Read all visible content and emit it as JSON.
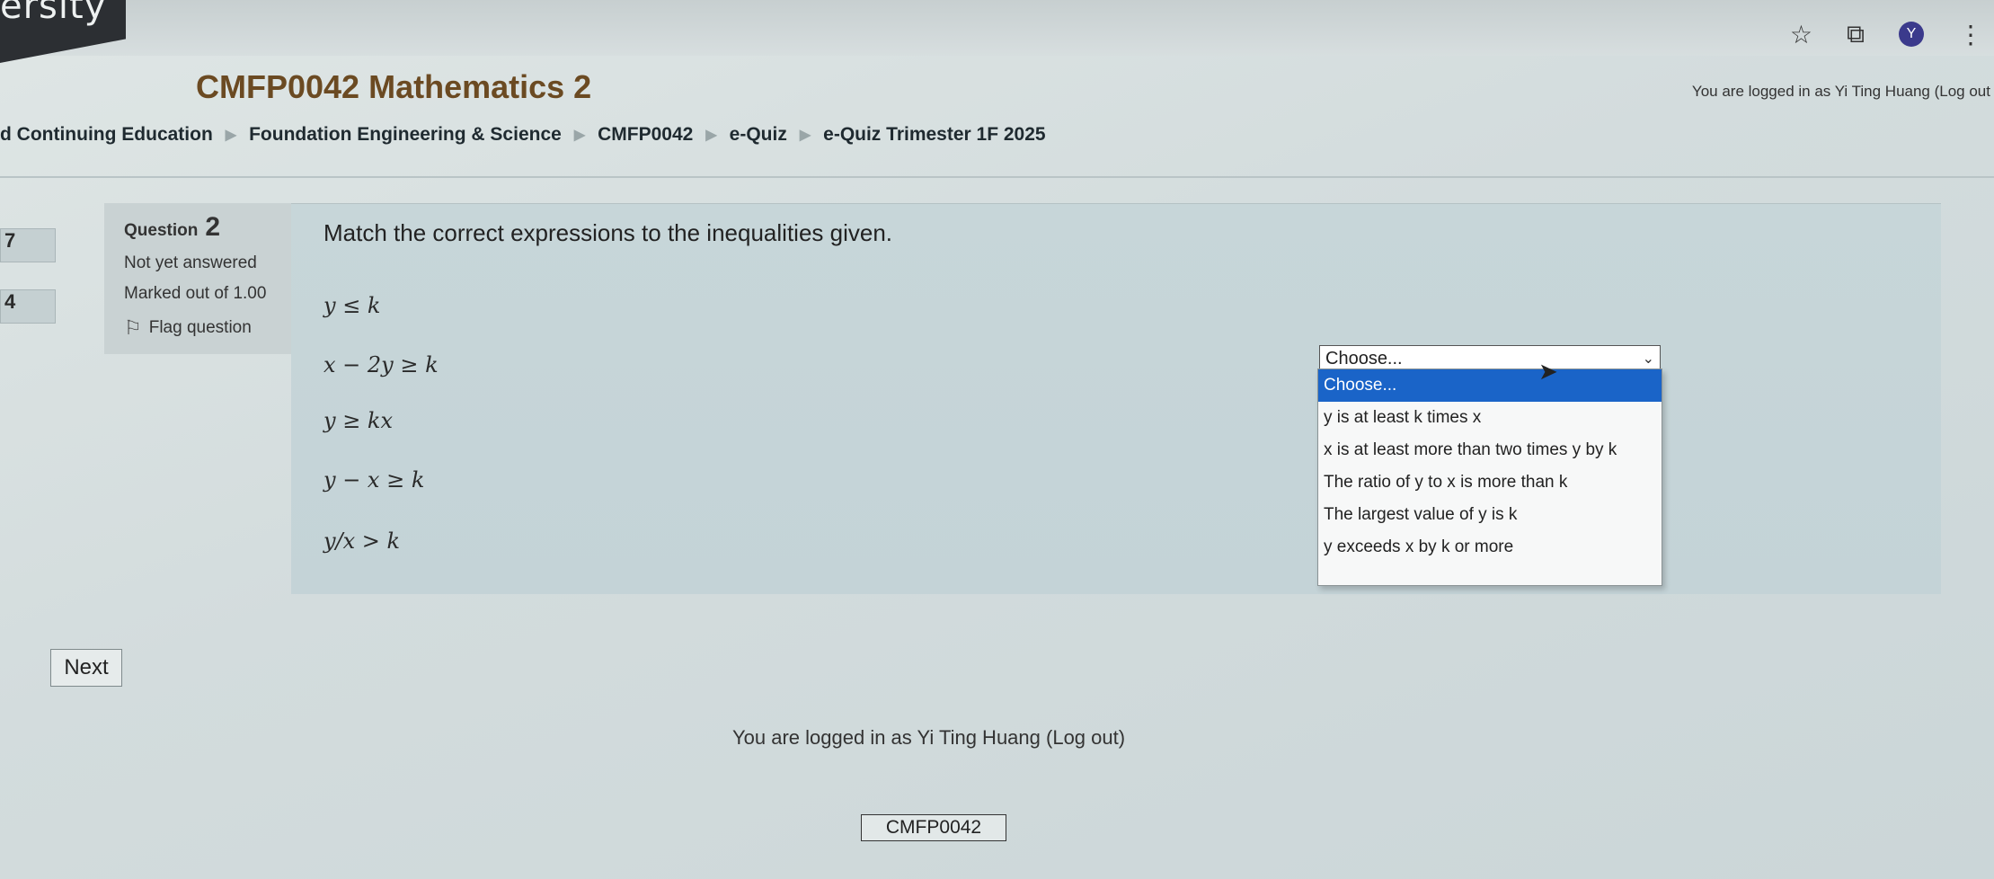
{
  "browser": {
    "icons": [
      "star-icon",
      "extension-icon",
      "profile-avatar",
      "more-vert-icon"
    ],
    "avatar_letter": "Y",
    "star_glyph": "☆",
    "ext_glyph": "⧉",
    "menu_glyph": "⋮"
  },
  "site": {
    "logo_text": "ersity",
    "course_title": "CMFP0042 Mathematics 2",
    "login_top": "You are logged in as Yi Ting Huang (Log out"
  },
  "breadcrumb": {
    "items": [
      "d Continuing Education",
      "Foundation Engineering & Science",
      "CMFP0042",
      "e-Quiz",
      "e-Quiz Trimester 1F 2025"
    ],
    "separator": "▶"
  },
  "left_nav": [
    "7",
    "4"
  ],
  "question": {
    "label": "Question",
    "number": "2",
    "status": "Not yet answered",
    "marks": "Marked out of 1.00",
    "flag_label": "Flag question",
    "text": "Match the correct expressions to the inequalities given.",
    "expressions": [
      "y ≤ k",
      "x − 2y ≥ k",
      "y ≥ kx",
      "y − x ≥ k",
      "y/x > k"
    ]
  },
  "select": {
    "current": "Choose...",
    "options": [
      "Choose...",
      "y is at least k times x",
      "x is at least more than two times y by k",
      "The ratio of y to x is more than k",
      "The largest value of y is k",
      "y exceeds x by k or more"
    ],
    "highlighted_index": 0
  },
  "nav": {
    "next_label": "Next"
  },
  "footer": {
    "login_text": "You are logged in as Yi Ting Huang (Log out)",
    "course_code": "CMFP0042"
  },
  "colors": {
    "title": "#6b4a22",
    "highlight": "#1a64c8",
    "content_bg": "#c7d6d9"
  }
}
